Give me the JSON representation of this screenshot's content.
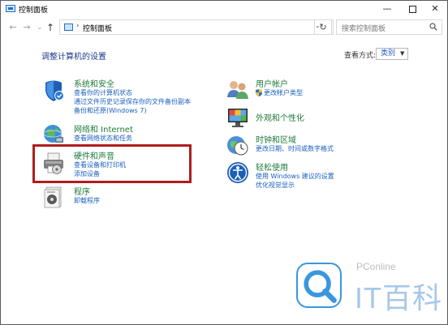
{
  "window": {
    "title": "控制面板",
    "minimize_glyph": "—",
    "close_glyph": "✕"
  },
  "navbar": {
    "back_glyph": "←",
    "forward_glyph": "→",
    "recent_glyph": "⌄",
    "up_glyph": "↑",
    "separator": "›",
    "address": "控制面板",
    "address_dropdown": "⌄",
    "refresh_glyph": "↻",
    "search_placeholder": "搜索控制面板"
  },
  "content": {
    "heading": "调整计算机的设置",
    "view_by_label": "查看方式:",
    "view_by_value": "类别",
    "view_by_caret": "▼"
  },
  "categories_left": [
    {
      "icon": "shield-icon",
      "title": "系统和安全",
      "links": [
        "查看你的计算机状态",
        "通过文件历史记录保存你的文件备份副本",
        "备份和还原(Windows 7)"
      ]
    },
    {
      "icon": "network-icon",
      "title": "网络和 Internet",
      "links": [
        "查看网络状态和任务"
      ]
    },
    {
      "icon": "printer-icon",
      "title": "硬件和声音",
      "links": [
        "查看设备和打印机",
        "添加设备"
      ]
    },
    {
      "icon": "programs-icon",
      "title": "程序",
      "links": [
        "卸载程序"
      ]
    }
  ],
  "categories_right": [
    {
      "icon": "users-icon",
      "title": "用户帐户",
      "links": [
        "更改帐户类型"
      ]
    },
    {
      "icon": "appearance-icon",
      "title": "外观和个性化",
      "links": []
    },
    {
      "icon": "clock-icon",
      "title": "时钟和区域",
      "links": [
        "更改日期、时间或数字格式"
      ]
    },
    {
      "icon": "accessibility-icon",
      "title": "轻松使用",
      "links": [
        "使用 Windows 建议的设置",
        "优化视觉显示"
      ]
    }
  ],
  "watermark": {
    "line1": "PConline",
    "line2": "IT百科"
  },
  "colors": {
    "highlight_border": "#b01d1d",
    "category_title": "#1f7a3a",
    "link": "#1a5fbf",
    "heading": "#1e3a8a"
  }
}
